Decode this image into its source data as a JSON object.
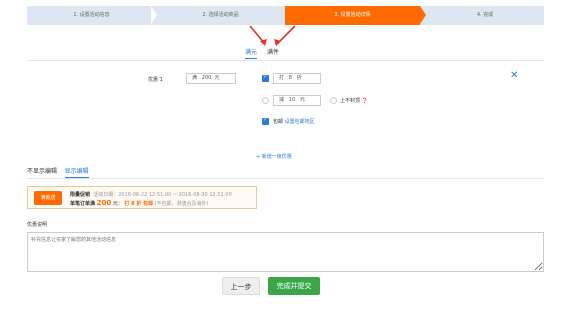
{
  "steps": [
    "1. 设置活动信息",
    "2. 选择活动商品",
    "3. 设置活动详情",
    "4. 完成"
  ],
  "tabs": [
    "满元",
    "满件"
  ],
  "tier_label": "优惠 1",
  "threshold": {
    "prefix": "满",
    "value": "200",
    "unit": "元"
  },
  "discount": {
    "prefix": "打",
    "value": "8",
    "unit": "折"
  },
  "reduce": {
    "prefix": "减",
    "value": "10",
    "unit": "元"
  },
  "no_cap": "上不封顶",
  "free_ship": "包邮",
  "free_ship_link": "设置包邮地区",
  "add_tier": "+ 新增一级优惠",
  "display_tabs": [
    "不显示编辑",
    "显示编辑"
  ],
  "preview": {
    "badge": "满就送",
    "title": "限量促销",
    "date_label": "活动日期：2016-08-22 12:51:00 ~ 2016-08-30 12:51:00",
    "rule_prefix": "单笔订单满",
    "amount": "200",
    "rule_unit": "元：",
    "rule_discount": "打 8 折",
    "rule_ship": "包邮",
    "rule_note": "(不包邮，港澳台及海外)"
  },
  "desc_label": "优惠说明",
  "desc_placeholder": "补充信息让买家了解您的其他活动信息",
  "buttons": {
    "prev": "上一步",
    "submit": "完成并提交"
  },
  "colors": {
    "accent": "#ff6b00",
    "blue": "#2d7bd4",
    "green": "#3aa648"
  }
}
